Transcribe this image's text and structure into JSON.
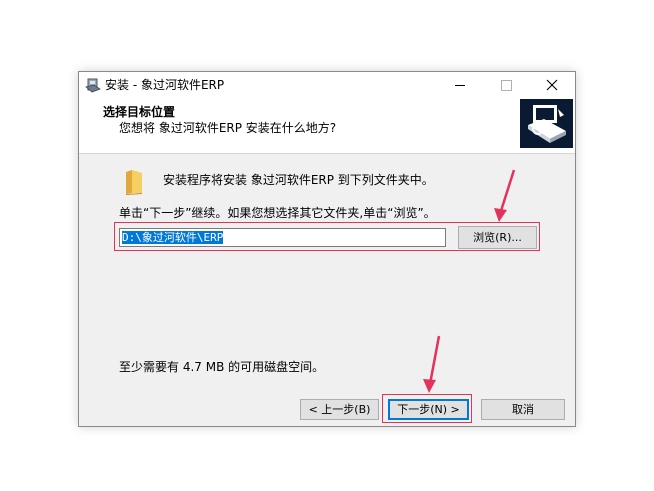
{
  "window": {
    "title": "安装 - 象过河软件ERP"
  },
  "header": {
    "title": "选择目标位置",
    "subtitle": "您想将 象过河软件ERP 安装在什么地方?"
  },
  "body": {
    "install_text": "安装程序将安装 象过河软件ERP 到下列文件夹中。",
    "continue_text": "单击“下一步”继续。如果您想选择其它文件夹,单击“浏览”。",
    "path_value": "D:\\象过河软件\\ERP",
    "browse_label": "浏览(R)...",
    "space_text": "至少需要有 4.7 MB 的可用磁盘空间。"
  },
  "buttons": {
    "back_label": "< 上一步(B)",
    "next_label": "下一步(N) >",
    "cancel_label": "取消"
  },
  "icons": {
    "app": "installer-icon",
    "folder": "folder-icon",
    "header_logo": "computer-box-icon",
    "annotation": "red-arrow-icon"
  },
  "colors": {
    "accent": "#0078d7",
    "annotation": "#e2335a",
    "logo_bg": "#0a1a33"
  }
}
